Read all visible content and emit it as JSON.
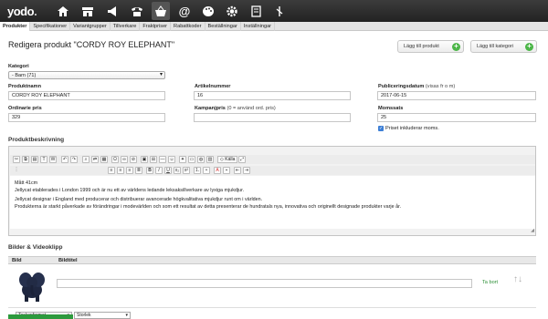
{
  "app": {
    "logo": "yodo",
    "logo_dot": "."
  },
  "nav_icons": [
    "home-icon",
    "shop-icon",
    "megaphone-icon",
    "phone-icon",
    "basket-icon",
    "at-icon",
    "palette-icon",
    "gear-icon",
    "document-icon",
    "tools-icon"
  ],
  "tabs": [
    {
      "label": "Produkter",
      "active": true
    },
    {
      "label": "Specifikationer"
    },
    {
      "label": "Variantgrupper"
    },
    {
      "label": "Tillverkare"
    },
    {
      "label": "Fraktpriser"
    },
    {
      "label": "Rabattkoder"
    },
    {
      "label": "Beställningar"
    },
    {
      "label": "Inställningar"
    }
  ],
  "page": {
    "title": "Redigera produkt \"CORDY ROY ELEPHANT\""
  },
  "buttons": {
    "add_product": "Lägg till produkt",
    "add_category": "Lägg till kategori"
  },
  "form": {
    "category_label": "Kategori",
    "category_value": "- Barn (71)",
    "name_label": "Produktnamn",
    "name_value": "CORDY ROY ELEPHANT",
    "article_label": "Artikelnummer",
    "article_value": "16",
    "published_label": "Publiceringsdatum",
    "published_note": "(visas fr o m)",
    "published_value": "2017-06-15",
    "price_label": "Ordinarie pris",
    "price_value": "329",
    "campaign_label": "Kampanjpris",
    "campaign_note": "(0 = använd ord. pris)",
    "campaign_value": "",
    "vat_label": "Momssats",
    "vat_value": "25",
    "vat_included": "Priset inkluderar moms."
  },
  "description": {
    "section": "Produktbeskrivning",
    "format_select": "Teckenformat",
    "size_select": "Storlek",
    "source_label": "Källa",
    "lines": [
      "Mått 41cm",
      "Jellycat etablerades i London 1999 och är nu ett av världens ledande leksaksillverkare av lyxiga mjukdjur.",
      "Jellycat designar i England med producerar och distribuerar avancerade högkvalitativa mjukdjur runt om i världen.",
      "Produkterna är starkt påverkade av förändringar i modevärlden och som ett resultat av detta presenterar de hundratals nya, innovativa och originellt designade produkter varje år."
    ]
  },
  "media": {
    "section": "Bilder & Videoklipp",
    "col_image": "Bild",
    "col_title": "Bildtitel",
    "remove": "Ta bort",
    "title_value": ""
  }
}
